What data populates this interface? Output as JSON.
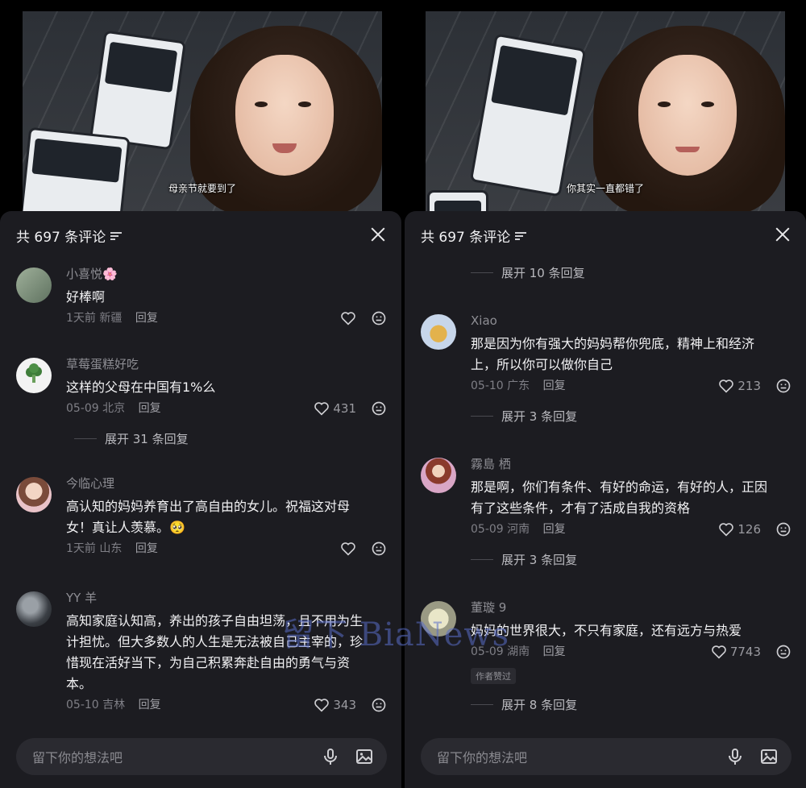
{
  "left": {
    "subtitle": "母亲节就要到了",
    "header": "共 697 条评论",
    "input_placeholder": "留下你的想法吧",
    "comments": [
      {
        "name": "小喜悦🌸",
        "text": "好棒啊",
        "time": "1天前",
        "location": "新疆",
        "reply": "回复",
        "likes": ""
      },
      {
        "name": "草莓蛋糕好吃",
        "text": "这样的父母在中国有1%么",
        "time": "05-09",
        "location": "北京",
        "reply": "回复",
        "likes": "431"
      },
      {
        "name": "今临心理",
        "text": "高认知的妈妈养育出了高自由的女儿。祝福这对母女！真让人羡慕。🥺",
        "time": "1天前",
        "location": "山东",
        "reply": "回复",
        "likes": ""
      },
      {
        "name": "YY 羊",
        "text": "高知家庭认知高，养出的孩子自由坦荡，且不用为生计担忧。但大多数人的人生是无法被自己主宰的，珍惜现在活好当下，为自己积累奔赴自由的勇气与资本。",
        "time": "05-10",
        "location": "吉林",
        "reply": "回复",
        "likes": "343"
      }
    ],
    "expand": [
      "展开 31 条回复"
    ]
  },
  "right": {
    "subtitle": "你其实一直都错了",
    "header": "共 697 条评论",
    "input_placeholder": "留下你的想法吧",
    "comments": [
      {
        "name": "Xiao",
        "text": "那是因为你有强大的妈妈帮你兜底，精神上和经济上，所以你可以做你自己",
        "time": "05-10",
        "location": "广东",
        "reply": "回复",
        "likes": "213"
      },
      {
        "name": "霧島 栖",
        "text": "那是啊，你们有条件、有好的命运，有好的人，正因有了这些条件，才有了活成自我的资格",
        "time": "05-09",
        "location": "河南",
        "reply": "回复",
        "likes": "126"
      },
      {
        "name": "董璇 9",
        "text": "妈妈的世界很大，不只有家庭，还有远方与热爱",
        "time": "05-09",
        "location": "湖南",
        "reply": "回复",
        "likes": "7743",
        "tag": "作者赞过"
      }
    ],
    "expand": [
      "展开 10 条回复",
      "展开 3 条回复",
      "展开 3 条回复",
      "展开 8 条回复"
    ]
  },
  "watermark": "留下 BiaNews",
  "colors": {
    "sheet": "#1c1c21",
    "text": "#f2f2f4",
    "muted": "#7f7f86"
  }
}
